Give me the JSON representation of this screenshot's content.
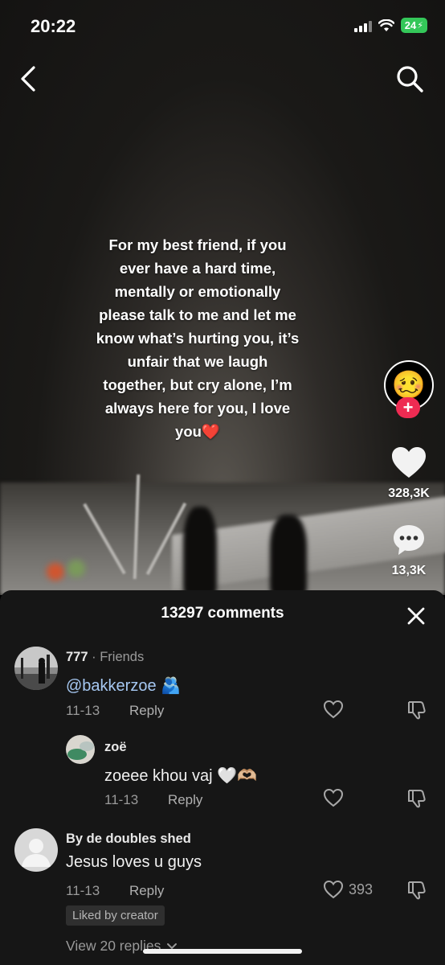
{
  "status_bar": {
    "time": "20:22",
    "battery": "24"
  },
  "video": {
    "caption_text": "For my best friend, if you ever have a hard time, mentally or emotionally please talk to me and let me know what’s hurting you, it’s unfair that we laugh together, but cry alone, I’m always here for you, I love you",
    "caption_emoji": "❤️",
    "avatar_emoji": "🥴",
    "follow_symbol": "+",
    "likes": "328,3K",
    "comments": "13,3K"
  },
  "comments_sheet": {
    "title": "13297 comments",
    "comments": [
      {
        "username": "777",
        "tag": "Friends",
        "text": "@bakkerzoe",
        "emoji": "🫂",
        "date": "11-13",
        "reply_label": "Reply",
        "replies": [
          {
            "username": "zoë",
            "text": "zoeee khou vaj",
            "emoji": "🤍🫶🏼",
            "date": "11-13",
            "reply_label": "Reply"
          }
        ]
      },
      {
        "username": "By de doubles shed",
        "text": "Jesus loves u guys",
        "date": "11-13",
        "reply_label": "Reply",
        "like_count": "393",
        "badge": "Liked by creator",
        "view_replies": "View 20 replies"
      }
    ]
  },
  "colors": {
    "accent_red": "#ee2b52",
    "mention_blue": "#a6c8f2",
    "battery_green": "#34c759"
  },
  "icons": [
    "back-icon",
    "search-icon",
    "heart-icon",
    "comment-icon",
    "close-icon",
    "like-outline-icon",
    "dislike-icon",
    "chevron-down-icon"
  ]
}
